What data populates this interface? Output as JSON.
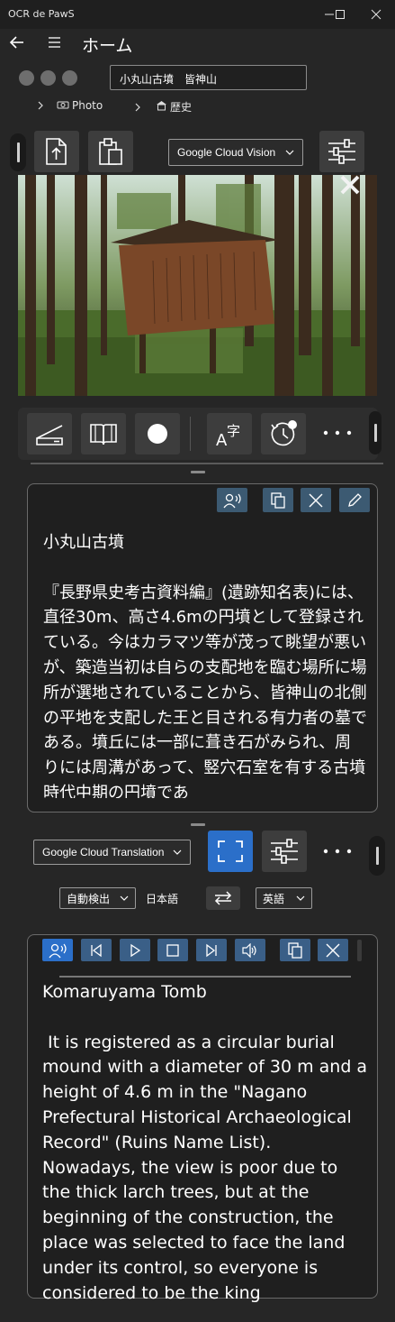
{
  "window": {
    "title": "OCR de PawS"
  },
  "header": {
    "page_title": "ホーム"
  },
  "location": {
    "value": "小丸山古墳　皆神山"
  },
  "breadcrumbs": [
    {
      "label": "Photo"
    },
    {
      "label": "歴史"
    }
  ],
  "ocr": {
    "engine": "Google Cloud Vision",
    "text": "小丸山古墳\n\n『長野県史考古資料編』(遺跡知名表)には、直径30m、高さ4.6mの円墳として登録されている。今はカラマツ等が茂って眺望が悪いが、築造当初は自らの支配地を臨む場所に場所が選地されていることから、皆神山の北側の平地を支配した王と目される有力者の墓である。墳丘には一部に葺き石がみられ、周りには周溝があって、竪穴石室を有する古墳時代中期の円墳であ"
  },
  "translation": {
    "engine": "Google Cloud Translation",
    "source_lang": "自動検出",
    "detected_lang": "日本語",
    "target_lang": "英語",
    "text": "Komaruyama Tomb\n\n It is registered as a circular burial mound with a diameter of 30 m and a height of 4.6 m in the \"Nagano Prefectural Historical Archaeological Record\" (Ruins Name List). Nowadays, the view is poor due to the thick larch trees, but at the beginning of the construction, the place was selected to face the land under its control, so everyone is considered to be the king"
  },
  "colors": {
    "background": "#262626",
    "accent_blue": "#2b6fc9",
    "button_gray": "#3d3d3d"
  }
}
